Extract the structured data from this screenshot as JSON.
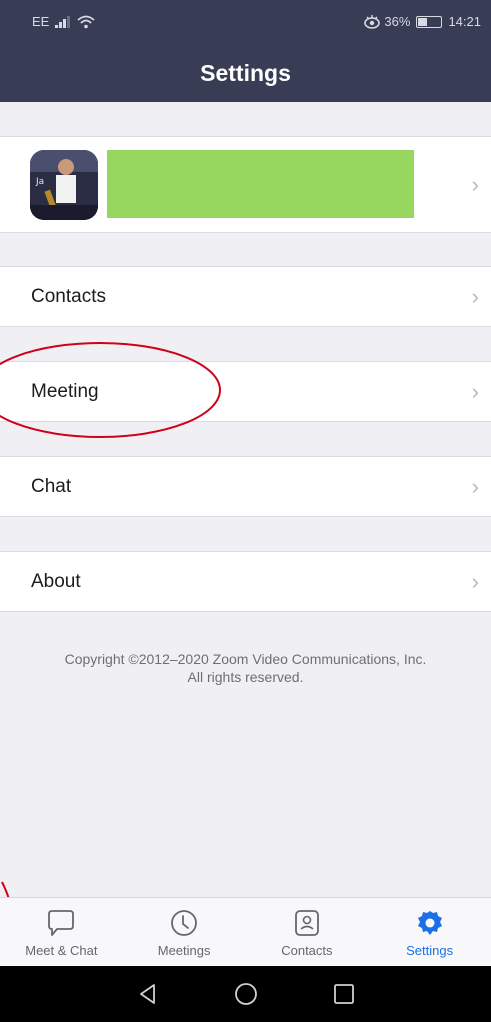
{
  "status_bar": {
    "carrier": "EE",
    "signal_icon": "signal-icon",
    "wifi_icon": "wifi-icon",
    "eye_icon": "eye-comfort-icon",
    "battery": "36%",
    "time": "14:21"
  },
  "header": {
    "title": "Settings"
  },
  "profile": {
    "name": "",
    "avatar_icon": "profile-photo"
  },
  "menu": {
    "items": [
      {
        "label": "Contacts"
      },
      {
        "label": "Meeting"
      },
      {
        "label": "Chat"
      },
      {
        "label": "About"
      }
    ]
  },
  "footer": {
    "copyright_line1": "Copyright ©2012–2020 Zoom Video Communications, Inc.",
    "copyright_line2": "All rights reserved."
  },
  "tabs": [
    {
      "label": "Meet & Chat",
      "icon": "chat-bubble-icon",
      "active": false
    },
    {
      "label": "Meetings",
      "icon": "clock-icon",
      "active": false
    },
    {
      "label": "Contacts",
      "icon": "contact-card-icon",
      "active": false
    },
    {
      "label": "Settings",
      "icon": "gear-icon",
      "active": true
    }
  ],
  "system_nav": {
    "back_icon": "back-triangle-icon",
    "home_icon": "home-circle-icon",
    "recents_icon": "recents-square-icon"
  },
  "colors": {
    "header_bg": "#383c54",
    "accent": "#1d6fe6",
    "name_highlight": "#97d75f",
    "annotation": "#d0021b"
  }
}
